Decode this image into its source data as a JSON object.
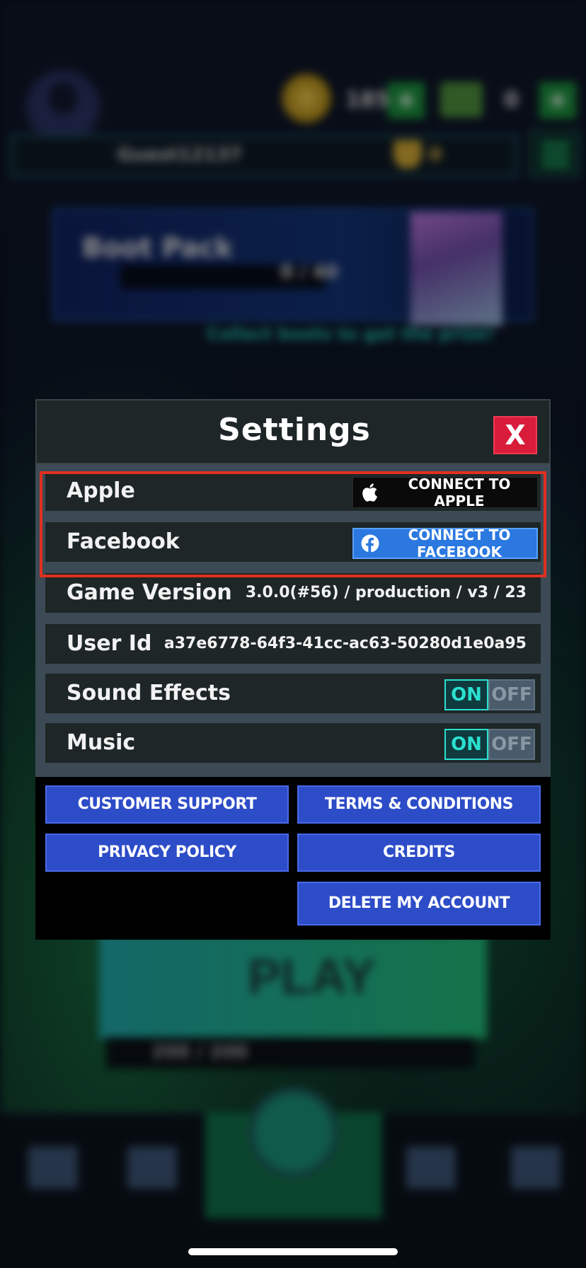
{
  "background": {
    "coins": "185",
    "cash": "0",
    "plus": "+",
    "player_name": "Guest12137",
    "trophies": "0",
    "pack_title": "Boot Pack",
    "pack_progress": "0 / 40",
    "pack_hint": "Collect boots to get the prize!",
    "play_label": "PLAY",
    "stamina": "200 / 200"
  },
  "settings": {
    "title": "Settings",
    "close_label": "X",
    "rows": {
      "apple": {
        "label": "Apple",
        "button": "CONNECT TO APPLE"
      },
      "facebook": {
        "label": "Facebook",
        "button": "CONNECT TO FACEBOOK"
      },
      "game_version": {
        "label": "Game Version",
        "value": "3.0.0(#56) / production / v3 / 23"
      },
      "user_id": {
        "label": "User Id",
        "value": "a37e6778-64f3-41cc-ac63-50280d1e0a95"
      },
      "sound_effects": {
        "label": "Sound Effects",
        "on": "ON",
        "off": "OFF",
        "state": "ON"
      },
      "music": {
        "label": "Music",
        "on": "ON",
        "off": "OFF",
        "state": "ON"
      }
    },
    "buttons": {
      "customer_support": "CUSTOMER SUPPORT",
      "terms": "TERMS & CONDITIONS",
      "privacy": "PRIVACY POLICY",
      "credits": "CREDITS",
      "delete_account": "DELETE MY ACCOUNT"
    }
  },
  "colors": {
    "accent_red": "#d81c3a",
    "highlight_red": "#e0301e",
    "facebook_blue": "#2a78e0",
    "link_button_blue": "#2d4cc8",
    "toggle_on": "#2ae0d0"
  },
  "icons": {
    "apple": "apple-logo-icon",
    "facebook": "facebook-logo-icon",
    "close": "close-icon"
  }
}
